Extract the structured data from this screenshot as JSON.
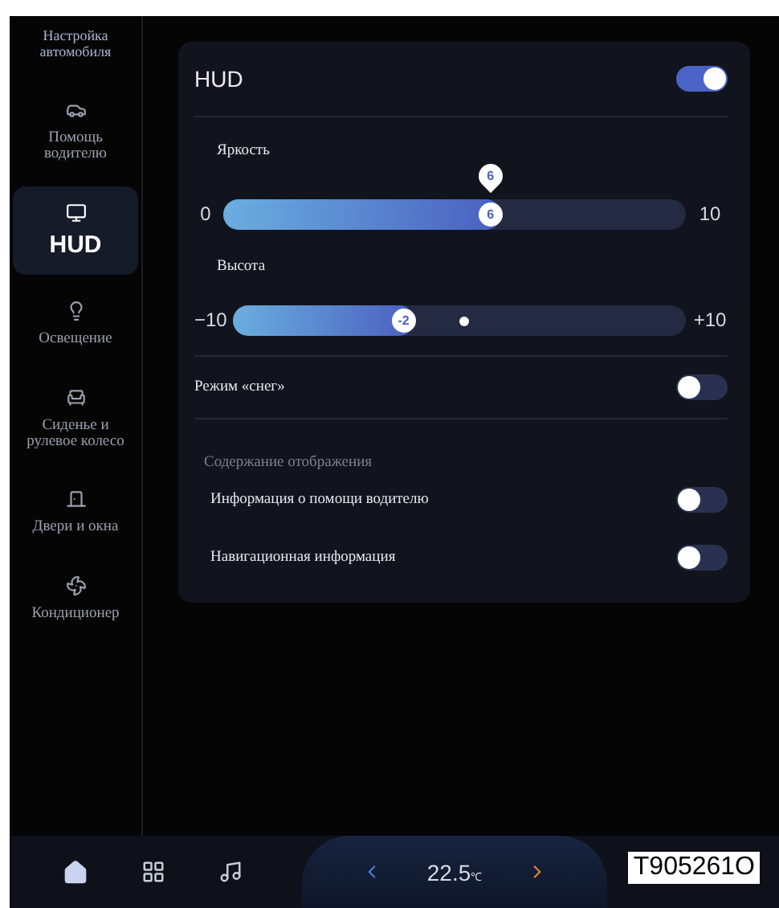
{
  "sidebar": {
    "header": "Настройка автомобиля",
    "items": [
      {
        "label": "Помощь водителю",
        "selected": false
      },
      {
        "label": "HUD",
        "selected": true
      },
      {
        "label": "Освещение",
        "selected": false
      },
      {
        "label": "Сиденье и рулевое колесо",
        "selected": false
      },
      {
        "label": "Двери и окна",
        "selected": false
      },
      {
        "label": "Кондиционер",
        "selected": false
      }
    ]
  },
  "panel": {
    "title": "HUD",
    "on": true,
    "sliders": [
      {
        "label": "Яркость",
        "min": "0",
        "max": "10",
        "value": "6",
        "bubble": "6",
        "level": 0.6
      },
      {
        "label": "Высота",
        "min": "−10",
        "max": "+10",
        "value": "-2",
        "level": 0.4
      }
    ],
    "snow_mode": {
      "label": "Режим «снег»",
      "on": false
    },
    "display_content": {
      "title": "Содержание отображения",
      "items": [
        {
          "label": "Информация о помощи водителю",
          "on": false
        },
        {
          "label": "Навигационная информация",
          "on": false
        }
      ]
    }
  },
  "bottom_bar": {
    "temperature": "22.5",
    "unit": "℃"
  },
  "document_label": "T905261O"
}
